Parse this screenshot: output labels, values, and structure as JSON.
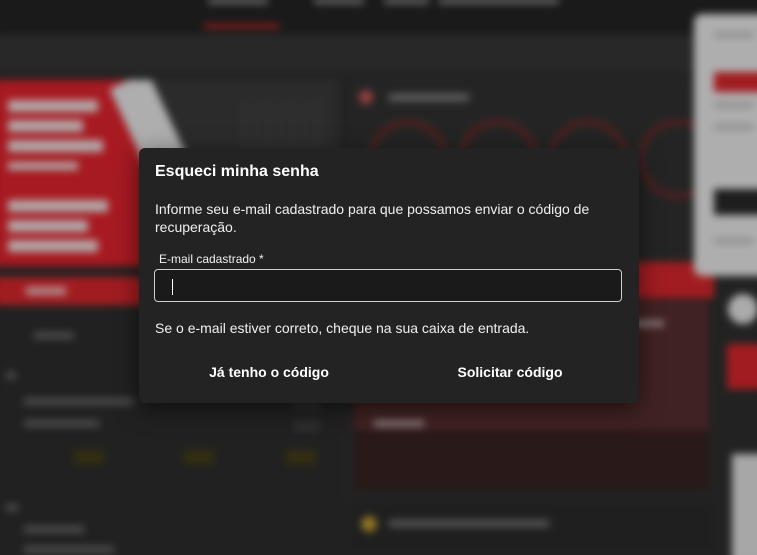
{
  "dialog": {
    "title": "Esqueci minha senha",
    "description": "Informe seu e-mail cadastrado para que possamos enviar o código de recuperação.",
    "email_label": "E-mail cadastrado *",
    "email_value": "",
    "email_placeholder": "",
    "note": "Se o e-mail estiver correto, cheque na sua caixa de entrada.",
    "have_code_label": "Já tenho o código",
    "request_code_label": "Solicitar código"
  },
  "colors": {
    "dialog_bg": "#232323",
    "accent_red": "#e0282e",
    "text": "#ffffff"
  }
}
